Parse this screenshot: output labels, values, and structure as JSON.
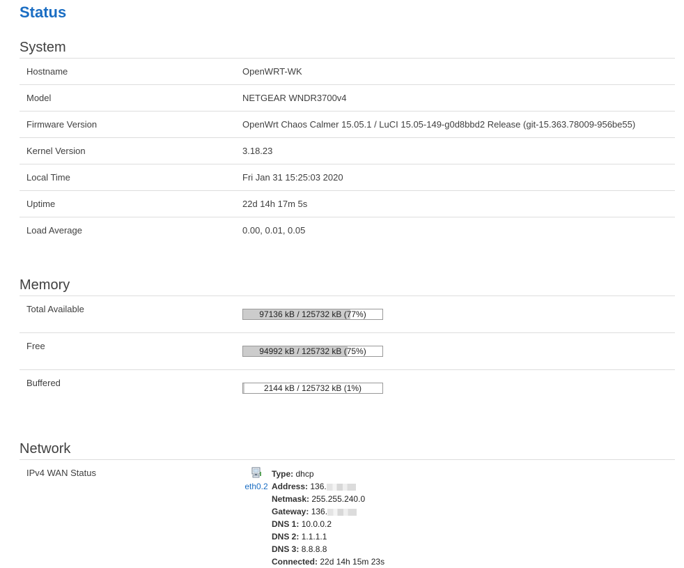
{
  "page": {
    "title": "Status"
  },
  "system": {
    "heading": "System",
    "rows": [
      {
        "label": "Hostname",
        "value": "OpenWRT-WK"
      },
      {
        "label": "Model",
        "value": "NETGEAR WNDR3700v4"
      },
      {
        "label": "Firmware Version",
        "value": "OpenWrt Chaos Calmer 15.05.1 / LuCI 15.05-149-g0d8bbd2 Release (git-15.363.78009-956be55)"
      },
      {
        "label": "Kernel Version",
        "value": "3.18.23"
      },
      {
        "label": "Local Time",
        "value": "Fri Jan 31 15:25:03 2020"
      },
      {
        "label": "Uptime",
        "value": "22d 14h 17m 5s"
      },
      {
        "label": "Load Average",
        "value": "0.00, 0.01, 0.05"
      }
    ]
  },
  "memory": {
    "heading": "Memory",
    "rows": [
      {
        "label": "Total Available",
        "text": "97136 kB / 125732 kB (77%)",
        "percent": 77
      },
      {
        "label": "Free",
        "text": "94992 kB / 125732 kB (75%)",
        "percent": 75
      },
      {
        "label": "Buffered",
        "text": "2144 kB / 125732 kB (1%)",
        "percent": 1
      }
    ]
  },
  "network": {
    "heading": "Network",
    "wan": {
      "label": "IPv4 WAN Status",
      "iface": "eth0.2",
      "icon": "network-port-icon",
      "fields": [
        {
          "k": "Type:",
          "v": "dhcp",
          "redacted": false
        },
        {
          "k": "Address:",
          "v": "136.",
          "redacted": true
        },
        {
          "k": "Netmask:",
          "v": "255.255.240.0",
          "redacted": false
        },
        {
          "k": "Gateway:",
          "v": "136.",
          "redacted": true
        },
        {
          "k": "DNS 1:",
          "v": "10.0.0.2",
          "redacted": false
        },
        {
          "k": "DNS 2:",
          "v": "1.1.1.1",
          "redacted": false
        },
        {
          "k": "DNS 3:",
          "v": "8.8.8.8",
          "redacted": false
        },
        {
          "k": "Connected:",
          "v": "22d 14h 15m 23s",
          "redacted": false
        }
      ]
    }
  }
}
